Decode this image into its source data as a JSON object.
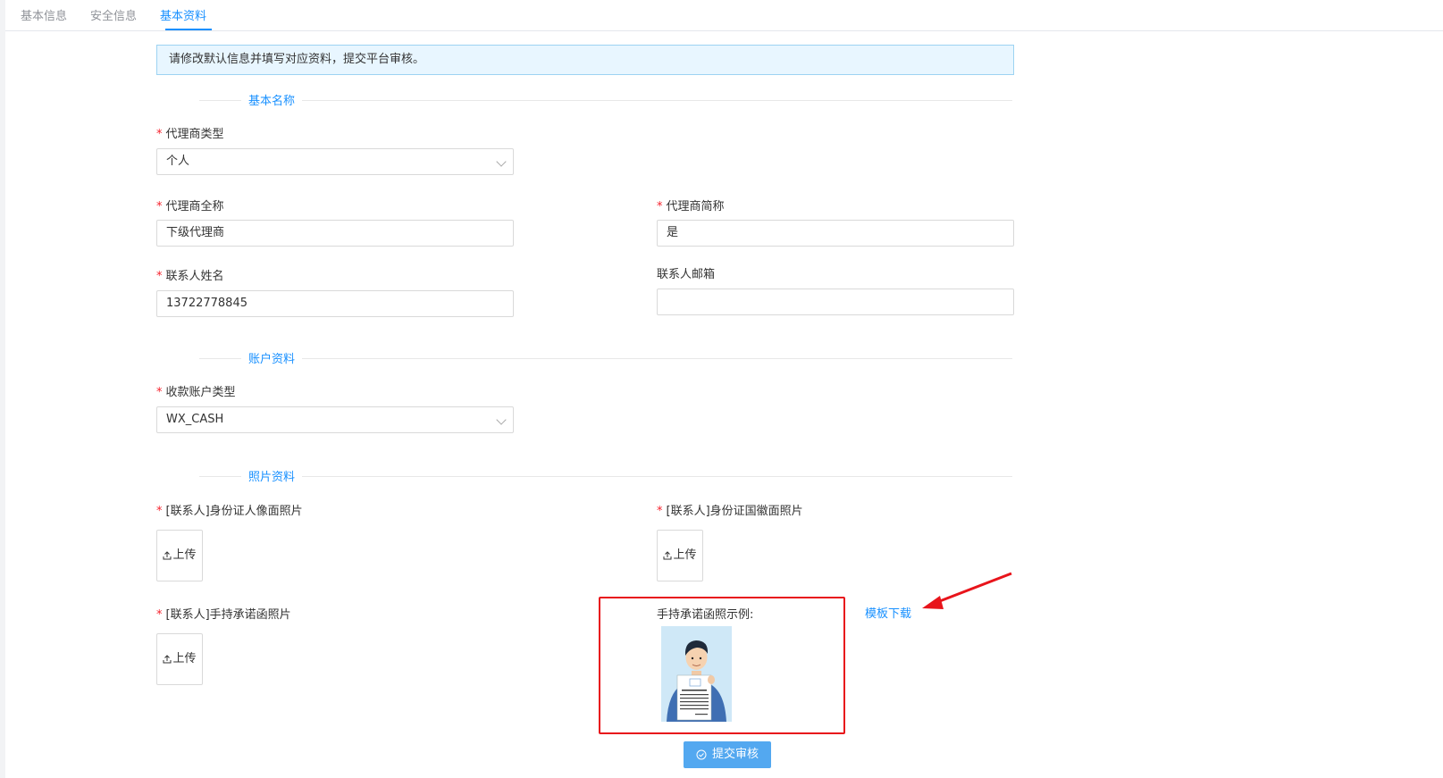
{
  "tabs": [
    {
      "label": "基本信息"
    },
    {
      "label": "安全信息"
    },
    {
      "label": "基本资料"
    }
  ],
  "notice": "请修改默认信息并填写对应资料，提交平台审核。",
  "sections": {
    "basic": "基本名称",
    "account": "账户资料",
    "photo": "照片资料"
  },
  "fields": {
    "agent_type": {
      "label": "代理商类型",
      "value": "个人"
    },
    "full_name": {
      "label": "代理商全称",
      "value": "下级代理商"
    },
    "short_name": {
      "label": "代理商简称",
      "value": "是"
    },
    "contact_name": {
      "label": "联系人姓名",
      "value": "13722778845"
    },
    "contact_email": {
      "label": "联系人邮箱",
      "value": ""
    },
    "account_type": {
      "label": "收款账户类型",
      "value": "WX_CASH"
    }
  },
  "photos": {
    "id_front": {
      "label": "[联系人]身份证人像面照片"
    },
    "id_back": {
      "label": "[联系人]身份证国徽面照片"
    },
    "commitment": {
      "label": "[联系人]手持承诺函照片"
    },
    "upload_label": "上传"
  },
  "example": {
    "label": "手持承诺函照示例:",
    "template_link": "模板下载"
  },
  "submit_label": "提交审核",
  "required_mark": "*",
  "colors": {
    "accent": "#1890ff",
    "required": "#f5222d",
    "highlight_box": "#e8141b",
    "submit_bg": "#53a8f0"
  }
}
